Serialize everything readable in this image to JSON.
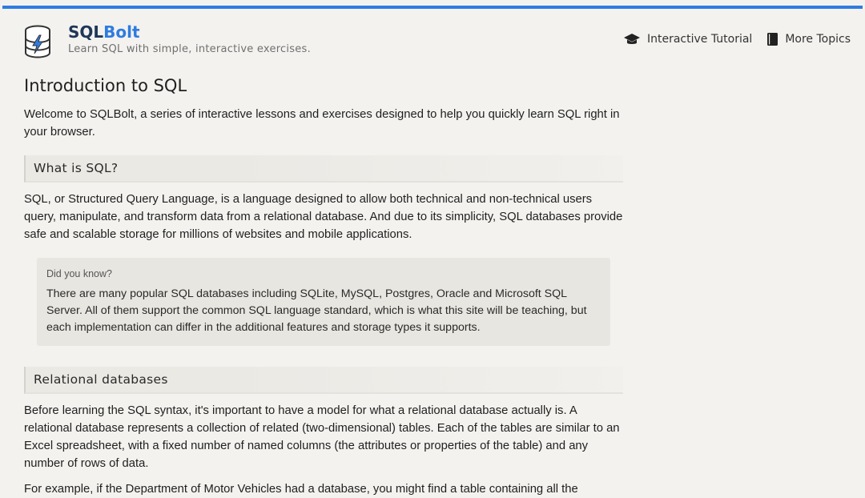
{
  "header": {
    "brand_part1": "SQL",
    "brand_part2": "Bolt",
    "tagline": "Learn SQL with simple, interactive exercises.",
    "logo_icon": "database-bolt-icon",
    "nav": [
      {
        "label": "Interactive Tutorial",
        "icon": "graduation-cap-icon"
      },
      {
        "label": "More Topics",
        "icon": "book-icon"
      }
    ]
  },
  "colors": {
    "accent": "#2f7ce0",
    "brand_dark": "#1f3658",
    "background": "#f3f2ef",
    "callout_background": "#e8e6e0"
  },
  "main": {
    "title": "Introduction to SQL",
    "intro": "Welcome to SQLBolt, a series of interactive lessons and exercises designed to help you quickly learn SQL right in your browser.",
    "section1": {
      "heading": "What is SQL?",
      "paragraph": "SQL, or Structured Query Language, is a language designed to allow both technical and non-technical users query, manipulate, and transform data from a relational database. And due to its simplicity, SQL databases provide safe and scalable storage for millions of websites and mobile applications."
    },
    "callout": {
      "title": "Did you know?",
      "text": "There are many popular SQL databases including SQLite, MySQL, Postgres, Oracle and Microsoft SQL Server. All of them support the common SQL language standard, which is what this site will be teaching, but each implementation can differ in the additional features and storage types it supports."
    },
    "section2": {
      "heading": "Relational databases",
      "paragraph": "Before learning the SQL syntax, it's important to have a model for what a relational database actually is. A relational database represents a collection of related (two-dimensional) tables. Each of the tables are similar to an Excel spreadsheet, with a fixed number of named columns (the attributes or properties of the table) and any number of rows of data.",
      "paragraph_cut": "For example, if the Department of Motor Vehicles had a database, you might find a table containing all the"
    }
  }
}
